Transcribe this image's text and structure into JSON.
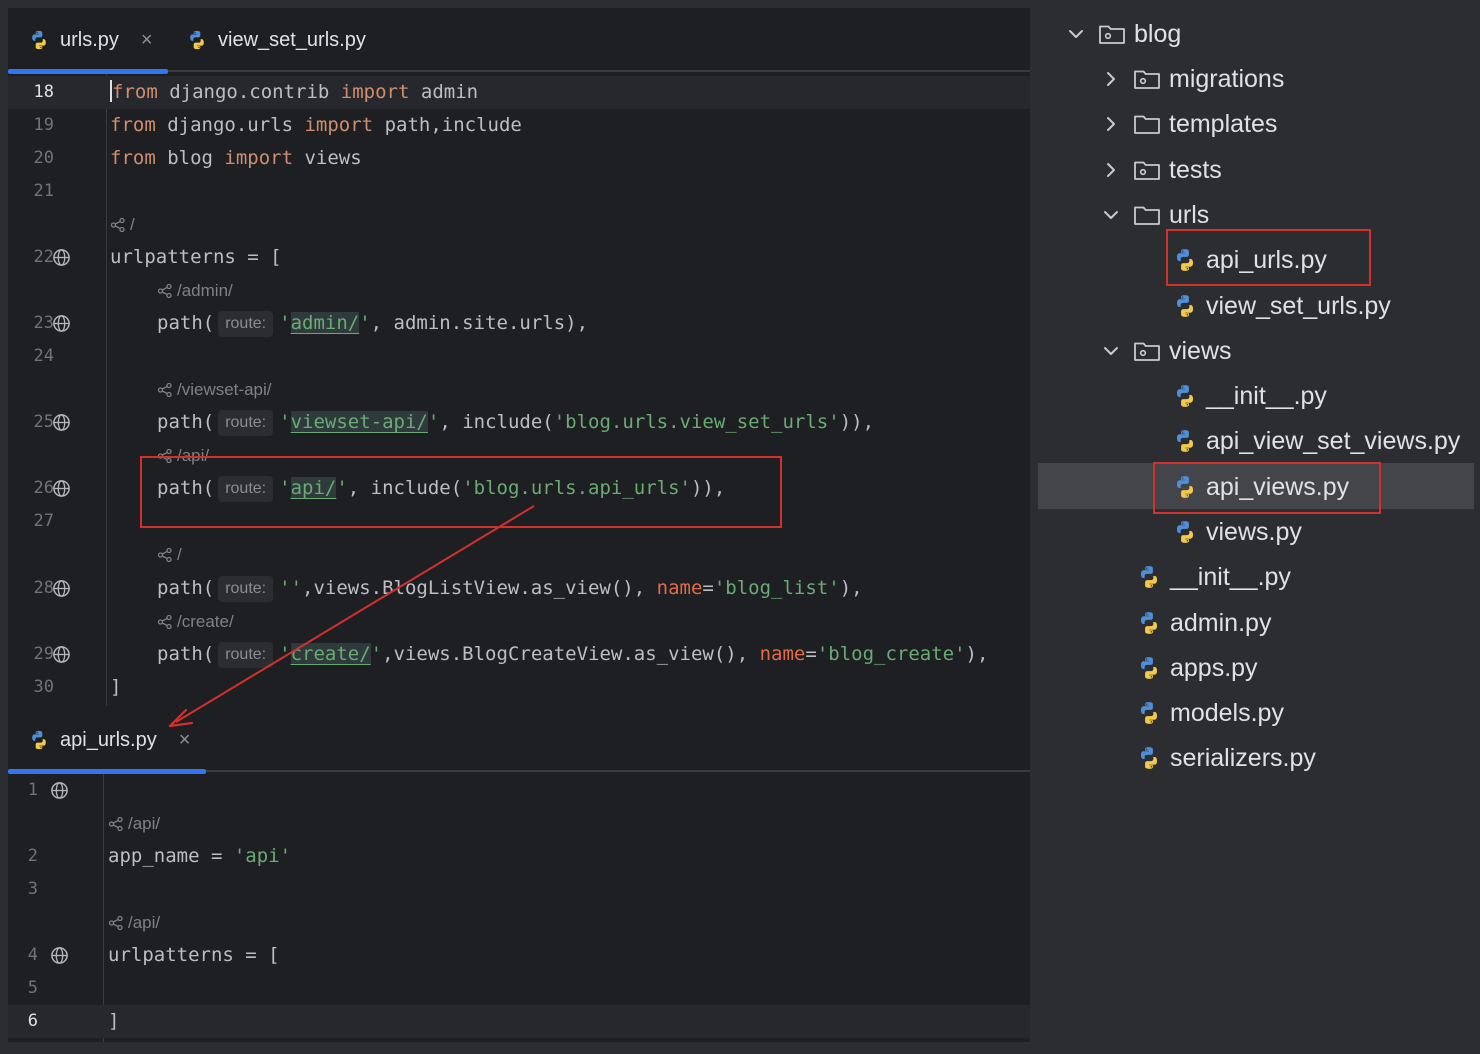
{
  "top_editor": {
    "tabs": [
      {
        "label": "urls.py",
        "active": true,
        "close": "×"
      },
      {
        "label": "view_set_urls.py",
        "active": false
      }
    ],
    "line_numbers": {
      "l18": "18",
      "l19": "19",
      "l20": "20",
      "l21": "21",
      "l22": "22",
      "l23": "23",
      "l24": "24",
      "l25": "25",
      "l26": "26",
      "l27": "27",
      "l28": "28",
      "l29": "29",
      "l30": "30"
    },
    "code": {
      "l18": {
        "kw1": "from",
        "mod": " django.contrib ",
        "kw2": "import",
        "name": " admin"
      },
      "l19": {
        "kw1": "from",
        "mod": " django.urls ",
        "kw2": "import",
        "name": " path,include"
      },
      "l20": {
        "kw1": "from",
        "mod": " blog ",
        "kw2": "import",
        "name": " views"
      },
      "lens_root": "/",
      "l22": "urlpatterns = [",
      "lens_admin": "/admin/",
      "l23": {
        "fn": "path(",
        "hint": "route:",
        "q1": "'",
        "route": "admin/",
        "q2": "'",
        "rest": ", admin.site.urls),"
      },
      "lens_viewset": "/viewset-api/",
      "l25": {
        "fn": "path(",
        "hint": "route:",
        "q1": "'",
        "route": "viewset-api/",
        "q2": "'",
        "mid": ", include(",
        "arg": "'blog.urls.view_set_urls'",
        "end": ")),"
      },
      "lens_api": "/api/",
      "l26": {
        "fn": "path(",
        "hint": "route:",
        "q1": "'",
        "route": "api/",
        "q2": "'",
        "mid": ", include(",
        "arg": "'blog.urls.api_urls'",
        "end": ")),"
      },
      "lens_root2": "/",
      "l28": {
        "fn": "path(",
        "hint": "route:",
        "route": "''",
        "mid": ",views.BlogListView.as_view(), ",
        "param": "name",
        "eq": "=",
        "arg": "'blog_list'",
        "end": "),"
      },
      "lens_create": "/create/",
      "l29": {
        "fn": "path(",
        "hint": "route:",
        "q1": "'",
        "route": "create/",
        "q2": "'",
        "mid": ",views.BlogCreateView.as_view(), ",
        "param": "name",
        "eq": "=",
        "arg": "'blog_create'",
        "end": "),"
      },
      "l30": "]"
    }
  },
  "bottom_editor": {
    "tab": {
      "label": "api_urls.py",
      "close": "×"
    },
    "line_numbers": {
      "l1": "1",
      "l2": "2",
      "l3": "3",
      "l4": "4",
      "l5": "5",
      "l6": "6"
    },
    "code": {
      "lens_api1": "/api/",
      "l2": {
        "name": "app_name = ",
        "str": "'api'"
      },
      "lens_api2": "/api/",
      "l4": "urlpatterns = [",
      "l6": "]"
    }
  },
  "project_tree": {
    "blog": "blog",
    "migrations": "migrations",
    "templates": "templates",
    "tests": "tests",
    "urls": "urls",
    "api_urls": "api_urls.py",
    "view_set_urls": "view_set_urls.py",
    "views": "views",
    "views_init": "__init__.py",
    "api_view_set_views": "api_view_set_views.py",
    "api_views": "api_views.py",
    "views_py": "views.py",
    "blog_init": "__init__.py",
    "admin": "admin.py",
    "apps": "apps.py",
    "models": "models.py",
    "serializers": "serializers.py"
  },
  "colors": {
    "accent": "#3574f0",
    "annotation_red": "#d0312d",
    "keyword": "#cf8e6d",
    "string": "#6aab73",
    "named_param": "#e06c4a"
  }
}
